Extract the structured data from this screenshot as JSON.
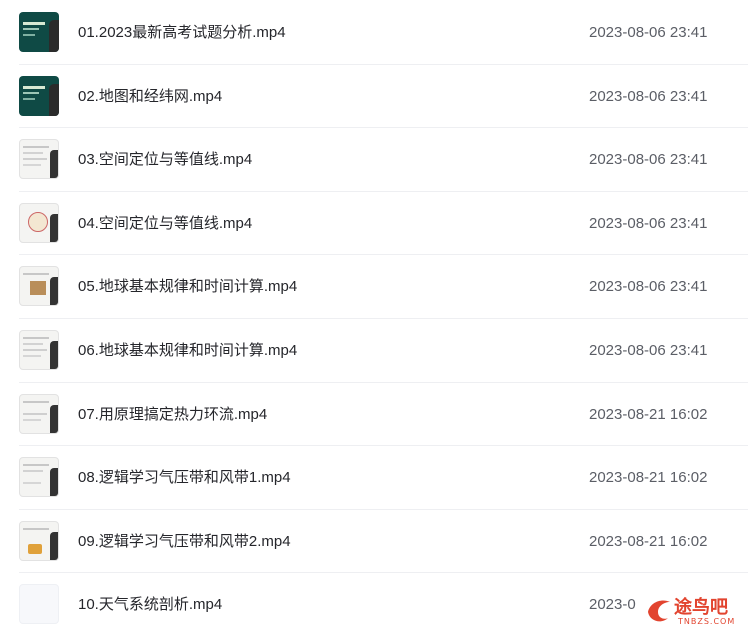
{
  "files": [
    {
      "name": "01.2023最新高考试题分析.mp4",
      "date": "2023-08-06 23:41",
      "thumb": "dark"
    },
    {
      "name": "02.地图和经纬网.mp4",
      "date": "2023-08-06 23:41",
      "thumb": "dark"
    },
    {
      "name": "03.空间定位与等值线.mp4",
      "date": "2023-08-06 23:41",
      "thumb": "light-chart"
    },
    {
      "name": "04.空间定位与等值线.mp4",
      "date": "2023-08-06 23:41",
      "thumb": "light-map"
    },
    {
      "name": "05.地球基本规律和时间计算.mp4",
      "date": "2023-08-06 23:41",
      "thumb": "light-photo"
    },
    {
      "name": "06.地球基本规律和时间计算.mp4",
      "date": "2023-08-06 23:41",
      "thumb": "light-chart"
    },
    {
      "name": "07.用原理搞定热力环流.mp4",
      "date": "2023-08-21 16:02",
      "thumb": "light-chart"
    },
    {
      "name": "08.逻辑学习气压带和风带1.mp4",
      "date": "2023-08-21 16:02",
      "thumb": "light-chart"
    },
    {
      "name": "09.逻辑学习气压带和风带2.mp4",
      "date": "2023-08-21 16:02",
      "thumb": "light-orange"
    },
    {
      "name": "10.天气系统剖析.mp4",
      "date": "2023-0",
      "thumb": "empty"
    }
  ],
  "watermark": {
    "brand": "途鸟吧",
    "domain": "TNBZS.COM"
  }
}
